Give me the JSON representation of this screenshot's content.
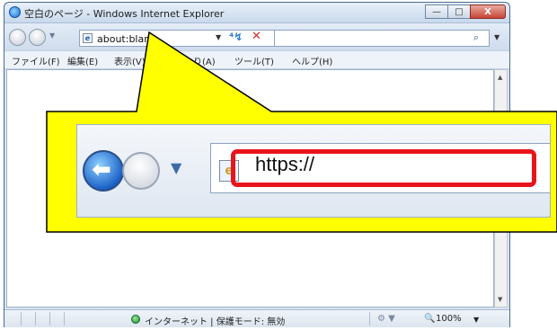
{
  "window": {
    "title": "空白のページ - Windows Internet Explorer",
    "buttons": {
      "minimize": "—",
      "maximize": "□",
      "close": "X"
    }
  },
  "navbar": {
    "address_value": "about:blank",
    "icons": [
      "back-icon",
      "forward-icon",
      "refresh-icon",
      "stop-icon",
      "search-icon"
    ]
  },
  "menu": {
    "items": [
      "ファイル(F)",
      "編集(E)",
      "表示(V)",
      "お気に入り(A)",
      "ツール(T)",
      "ヘルプ(H)"
    ]
  },
  "status": {
    "zone_text": "インターネット | 保護モード: 無効",
    "zoom_text": "100%",
    "zoom_icon": "magnifier-icon"
  },
  "callout": {
    "address_text": "https://",
    "highlight_color": "#e8141c",
    "callout_color": "#ffff00"
  }
}
